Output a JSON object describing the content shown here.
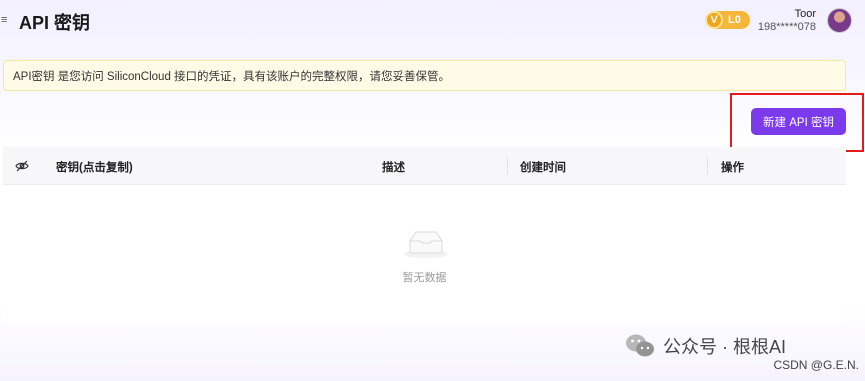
{
  "header": {
    "menu_glyph": "≡",
    "title": "API 密钥",
    "vip": {
      "icon_letter": "V",
      "level": "L0"
    },
    "user": {
      "name": "Toor",
      "phone": "198*****078"
    }
  },
  "notice": {
    "text": "API密钥 是您访问 SiliconCloud 接口的凭证，具有该账户的完整权限，请您妥善保管。"
  },
  "actions": {
    "create_label": "新建 API 密钥"
  },
  "table": {
    "columns": [
      "密钥(点击复制)",
      "描述",
      "创建时间",
      "操作"
    ],
    "empty_text": "暂无数据"
  },
  "watermark": {
    "main": "公众号 · 根根AI",
    "sub": "CSDN @G.E.N."
  },
  "colors": {
    "accent": "#7c3aed",
    "highlight": "#e51b1b",
    "vip": "#f5b73a"
  }
}
